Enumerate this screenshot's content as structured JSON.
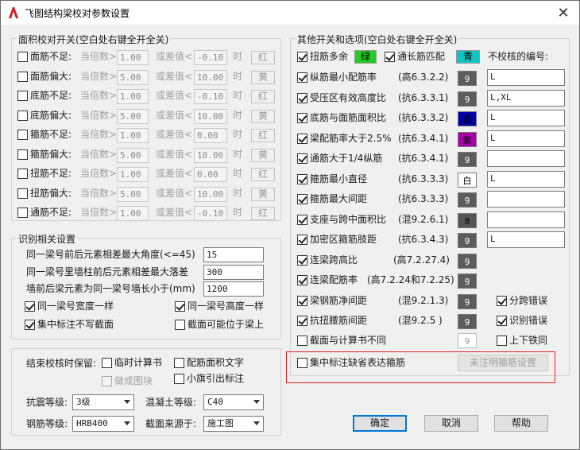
{
  "title": "飞图结构梁校对参数设置",
  "area_group": {
    "title": "面积校对开关(空白处右键全开全关)",
    "mult_label": "当倍数>",
    "diff_label": "或差值<",
    "when_label": "时",
    "rows": [
      {
        "label": "面筋不足:",
        "mult": "1.00",
        "diff": "-0.10",
        "color": "红"
      },
      {
        "label": "面筋偏大:",
        "mult": "5.00",
        "diff": "10.00",
        "color": "黄"
      },
      {
        "label": "底筋不足:",
        "mult": "1.00",
        "diff": "-0.10",
        "color": "红"
      },
      {
        "label": "底筋偏大:",
        "mult": "5.00",
        "diff": "10.00",
        "color": "黄"
      },
      {
        "label": "箍筋不足:",
        "mult": "1.00",
        "diff": "0.00",
        "color": "红"
      },
      {
        "label": "箍筋偏大:",
        "mult": "5.00",
        "diff": "10.00",
        "color": "黄"
      },
      {
        "label": "扭筋不足:",
        "mult": "1.00",
        "diff": "0.00",
        "color": "红"
      },
      {
        "label": "扭筋偏大:",
        "mult": "5.00",
        "diff": "10.00",
        "color": "黄"
      },
      {
        "label": "通筋不足:",
        "mult": "1.00",
        "diff": "-0.10",
        "color": "红"
      }
    ]
  },
  "recog_group": {
    "title": "识别相关设置",
    "fields": [
      {
        "label": "同一梁号前后元素相差最大角度(<=45)",
        "value": "15"
      },
      {
        "label": "同一梁号里墙柱前后元素相差最大落差",
        "value": "300"
      },
      {
        "label": "墙前后梁元素为同一梁号墙长小于(mm)",
        "value": "1200"
      }
    ],
    "checks": [
      {
        "label": "同一梁号宽度一样",
        "checked": true
      },
      {
        "label": "同一梁号高度一样",
        "checked": true
      },
      {
        "label": "集中标注不写截面",
        "checked": true
      },
      {
        "label": "截面可能位于梁上",
        "checked": false
      }
    ]
  },
  "bottom_group": {
    "keep_label": "结束校核时保留:",
    "checks": [
      {
        "label": "临时计算书",
        "checked": false
      },
      {
        "label": "配筋面积文字",
        "checked": false
      },
      {
        "label": "做成图块",
        "checked": false,
        "disabled": true
      },
      {
        "label": "小旗引出标注",
        "checked": false
      }
    ],
    "selects": [
      {
        "label": "抗震等级:",
        "value": "3级"
      },
      {
        "label": "混凝土等级:",
        "value": "C40"
      },
      {
        "label": "钢筋等级:",
        "value": "HRB400"
      },
      {
        "label": "截面来源于:",
        "value": "施工图"
      }
    ]
  },
  "other_group": {
    "title": "其他开关和选项(空白处右键全开全关)",
    "torsion_label": "扭筋多余",
    "torsion_color": "绿",
    "through_label": "通长筋匹配",
    "through_color": "青",
    "exclude_label": "不校核的编号:",
    "rows": [
      {
        "label": "纵筋最小配筋率",
        "code": "(高6.3.2.2)",
        "badge": "9",
        "text": "L"
      },
      {
        "label": "受压区有效高度比",
        "code": "(抗6.3.3.1)",
        "badge": "9",
        "text": "L,XL"
      },
      {
        "label": "底筋与面筋面积比",
        "code": "(抗6.3.3.2)",
        "badge": "蓝",
        "text": "L"
      },
      {
        "label": "梁配筋率大于2.5%",
        "code": "(抗6.3.4.1)",
        "badge": "紫",
        "text": "L"
      },
      {
        "label": "通筋大于1/4纵筋",
        "code": "(抗6.3.4.1)",
        "badge": "9",
        "text": ""
      },
      {
        "label": "箍筋最小直径",
        "code": "(抗6.3.3.3)",
        "badge": "白",
        "text": "L"
      },
      {
        "label": "箍筋最大间距",
        "code": "(抗6.3.3.3)",
        "badge": "9",
        "text": ""
      },
      {
        "label": "支座与跨中面积比",
        "code": "(混9.2.6.1)",
        "badge": "8",
        "text": ""
      },
      {
        "label": "加密区箍筋肢距",
        "code": "(抗6.3.4.3)",
        "badge": "9",
        "text": "L"
      },
      {
        "label": "连梁跨高比",
        "code": "(高7.2.27.4)",
        "badge": "9",
        "text": ""
      },
      {
        "label": "连梁配筋率",
        "code": "(高7.2.24和7.2.25)",
        "badge": "9",
        "text": ""
      },
      {
        "label": "梁钢筋净间距",
        "code": "(混9.2.1.3)",
        "badge": "9",
        "text": ""
      },
      {
        "label": "抗扭腰筋间距",
        "code": "(混9.2.5  )",
        "badge": "9",
        "text": ""
      }
    ],
    "side_checks": [
      {
        "label": "分跨错误",
        "checked": true
      },
      {
        "label": "识别错误",
        "checked": true
      },
      {
        "label": "上下铁同",
        "checked": false
      }
    ],
    "section_label": "截面与计算书不同",
    "section_badge": "9",
    "stirrup_label": "集中标注缺省表达箍筋",
    "stirrup_button": "未注明箍筋设置"
  },
  "buttons": {
    "ok": "确定",
    "cancel": "取消",
    "help": "帮助"
  },
  "colors": {
    "green": "#22cc22",
    "cyan": "#11c4c4",
    "blue": "#0000aa",
    "purple": "#aa00aa",
    "gray_badge": "#5c5c5c",
    "red_outline": "#e02020"
  }
}
